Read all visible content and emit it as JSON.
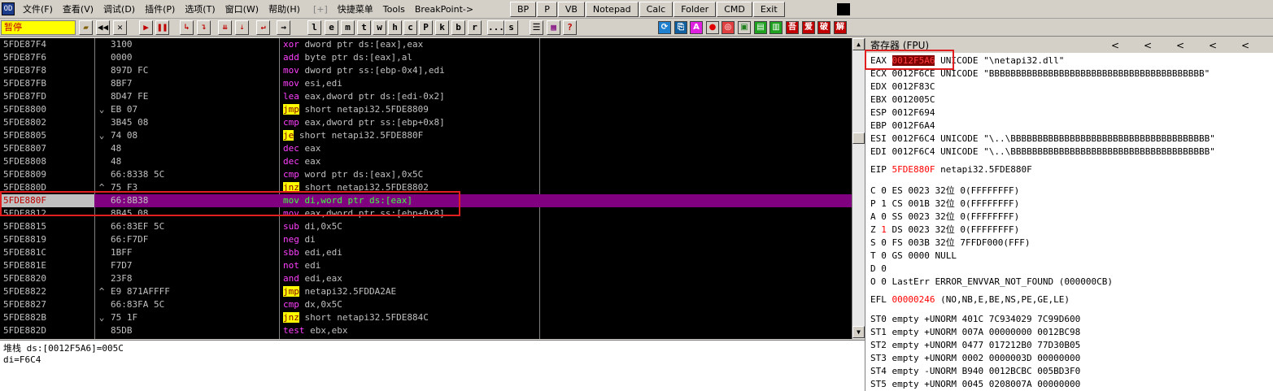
{
  "app_icon": "OD",
  "menu": [
    "文件(F)",
    "查看(V)",
    "调试(D)",
    "插件(P)",
    "选项(T)",
    "窗口(W)",
    "帮助(H)",
    "[+]",
    "快捷菜单",
    "Tools",
    "BreakPoint->"
  ],
  "tool_buttons": [
    "BP",
    "P",
    "VB",
    "Notepad",
    "Calc",
    "Folder",
    "CMD",
    "Exit"
  ],
  "status": "暂停",
  "toolbar_letters": [
    "l",
    "e",
    "m",
    "t",
    "w",
    "h",
    "c",
    "P",
    "k",
    "b",
    "r",
    "...",
    "s"
  ],
  "toolbar_icons": [
    "folder-icon",
    "rewind-icon",
    "close-icon",
    "run-icon",
    "pause-icon",
    "step-into-icon",
    "step-over-icon",
    "trace-into-icon",
    "trace-over-icon",
    "execute-till-return-icon",
    "go-to-icon"
  ],
  "disasm": [
    {
      "addr": "5FDE87F4",
      "arrow": "",
      "hex": "3100",
      "op": "xor",
      "args": "dword ptr ds:[eax],eax",
      "ctl": false
    },
    {
      "addr": "5FDE87F6",
      "arrow": "",
      "hex": "0000",
      "op": "add",
      "args": "byte ptr ds:[eax],al",
      "ctl": false
    },
    {
      "addr": "5FDE87F8",
      "arrow": "",
      "hex": "897D FC",
      "op": "mov",
      "args": "dword ptr ss:[ebp-0x4],edi",
      "ctl": false
    },
    {
      "addr": "5FDE87FB",
      "arrow": "",
      "hex": "8BF7",
      "op": "mov",
      "args": "esi,edi",
      "ctl": false
    },
    {
      "addr": "5FDE87FD",
      "arrow": "",
      "hex": "8D47 FE",
      "op": "lea",
      "args": "eax,dword ptr ds:[edi-0x2]",
      "ctl": false
    },
    {
      "addr": "5FDE8800",
      "arrow": "⌄",
      "hex": "EB 07",
      "op": "jmp",
      "args": "short netapi32.5FDE8809",
      "ctl": true
    },
    {
      "addr": "5FDE8802",
      "arrow": "",
      "hex": "3B45 08",
      "op": "cmp",
      "args": "eax,dword ptr ss:[ebp+0x8]",
      "ctl": false
    },
    {
      "addr": "5FDE8805",
      "arrow": "⌄",
      "hex": "74 08",
      "op": "je",
      "args": "short netapi32.5FDE880F",
      "ctl": true
    },
    {
      "addr": "5FDE8807",
      "arrow": "",
      "hex": "48",
      "op": "dec",
      "args": "eax",
      "ctl": false
    },
    {
      "addr": "5FDE8808",
      "arrow": "",
      "hex": "48",
      "op": "dec",
      "args": "eax",
      "ctl": false
    },
    {
      "addr": "5FDE8809",
      "arrow": "",
      "hex": "66:8338 5C",
      "op": "cmp",
      "args": "word ptr ds:[eax],0x5C",
      "ctl": false
    },
    {
      "addr": "5FDE880D",
      "arrow": "^",
      "hex": "75 F3",
      "op": "jnz",
      "args": "short netapi32.5FDE8802",
      "ctl": true
    },
    {
      "addr": "5FDE880F",
      "arrow": "",
      "hex": "66:8B38",
      "op": "mov",
      "args": "di,word ptr ds:[eax]",
      "ctl": false,
      "selected": true
    },
    {
      "addr": "5FDE8812",
      "arrow": "",
      "hex": "8B45 08",
      "op": "mov",
      "args": "eax,dword ptr ss:[ebp+0x8]",
      "ctl": false
    },
    {
      "addr": "5FDE8815",
      "arrow": "",
      "hex": "66:83EF 5C",
      "op": "sub",
      "args": "di,0x5C",
      "ctl": false
    },
    {
      "addr": "5FDE8819",
      "arrow": "",
      "hex": "66:F7DF",
      "op": "neg",
      "args": "di",
      "ctl": false
    },
    {
      "addr": "5FDE881C",
      "arrow": "",
      "hex": "1BFF",
      "op": "sbb",
      "args": "edi,edi",
      "ctl": false
    },
    {
      "addr": "5FDE881E",
      "arrow": "",
      "hex": "F7D7",
      "op": "not",
      "args": "edi",
      "ctl": false
    },
    {
      "addr": "5FDE8820",
      "arrow": "",
      "hex": "23F8",
      "op": "and",
      "args": "edi,eax",
      "ctl": false
    },
    {
      "addr": "5FDE8822",
      "arrow": "^",
      "hex": "E9 871AFFFF",
      "op": "jmp",
      "args": "netapi32.5FDDA2AE",
      "ctl": true
    },
    {
      "addr": "5FDE8827",
      "arrow": "",
      "hex": "66:83FA 5C",
      "op": "cmp",
      "args": "dx,0x5C",
      "ctl": false
    },
    {
      "addr": "5FDE882B",
      "arrow": "⌄",
      "hex": "75 1F",
      "op": "jnz",
      "args": "short netapi32.5FDE884C",
      "ctl": true
    },
    {
      "addr": "5FDE882D",
      "arrow": "",
      "hex": "85DB",
      "op": "test",
      "args": "ebx,ebx",
      "ctl": false
    }
  ],
  "info": [
    "堆栈 ds:[0012F5A6]=005C",
    "di=F6C4"
  ],
  "registers": {
    "title": "寄存器 (FPU)",
    "nav": [
      "<",
      "<",
      "<",
      "<",
      "<"
    ],
    "gp": [
      {
        "name": "EAX",
        "value": "0012F5A6",
        "comment": "UNICODE \"\\netapi32.dll\"",
        "highlight": true
      },
      {
        "name": "ECX",
        "value": "0012F6CE",
        "comment": "UNICODE \"BBBBBBBBBBBBBBBBBBBBBBBBBBBBBBBBBBBBBBBB\""
      },
      {
        "name": "EDX",
        "value": "0012F83C",
        "comment": ""
      },
      {
        "name": "EBX",
        "value": "0012005C",
        "comment": ""
      },
      {
        "name": "ESP",
        "value": "0012F694",
        "comment": ""
      },
      {
        "name": "EBP",
        "value": "0012F6A4",
        "comment": ""
      },
      {
        "name": "ESI",
        "value": "0012F6C4",
        "comment": "UNICODE \"\\..\\BBBBBBBBBBBBBBBBBBBBBBBBBBBBBBBBBBBBB\""
      },
      {
        "name": "EDI",
        "value": "0012F6C4",
        "comment": "UNICODE \"\\..\\BBBBBBBBBBBBBBBBBBBBBBBBBBBBBBBBBBBBB\""
      }
    ],
    "eip": {
      "name": "EIP",
      "value": "5FDE880F",
      "comment": "netapi32.5FDE880F"
    },
    "flags": [
      {
        "flag": "C",
        "val": "0",
        "seg": "ES 0023 32位 0(FFFFFFFF)"
      },
      {
        "flag": "P",
        "val": "1",
        "seg": "CS 001B 32位 0(FFFFFFFF)"
      },
      {
        "flag": "A",
        "val": "0",
        "seg": "SS 0023 32位 0(FFFFFFFF)"
      },
      {
        "flag": "Z",
        "val": "1",
        "seg": "DS 0023 32位 0(FFFFFFFF)",
        "changed": true
      },
      {
        "flag": "S",
        "val": "0",
        "seg": "FS 003B 32位 7FFDF000(FFF)"
      },
      {
        "flag": "T",
        "val": "0",
        "seg": "GS 0000 NULL"
      },
      {
        "flag": "D",
        "val": "0",
        "seg": ""
      },
      {
        "flag": "O",
        "val": "0",
        "seg": "LastErr ERROR_ENVVAR_NOT_FOUND (000000CB)"
      }
    ],
    "efl": {
      "name": "EFL",
      "value": "00000246",
      "comment": "(NO,NB,E,BE,NS,PE,GE,LE)"
    },
    "fpu": [
      "ST0 empty +UNORM 401C 7C934029 7C99D600",
      "ST1 empty +UNORM 007A 00000000 0012BC98",
      "ST2 empty +UNORM 0477 017212B0 77D30B05",
      "ST3 empty +UNORM 0002 0000003D 00000000",
      "ST4 empty -UNORM B940 0012BCBC 005BD3F0",
      "ST5 empty +UNORM 0045 0208007A 00000000"
    ]
  },
  "colors": {
    "selected_row": "#800080",
    "register_changed": "#ff0000",
    "status_bg": "#ffff00",
    "annotation": "#e02020"
  }
}
